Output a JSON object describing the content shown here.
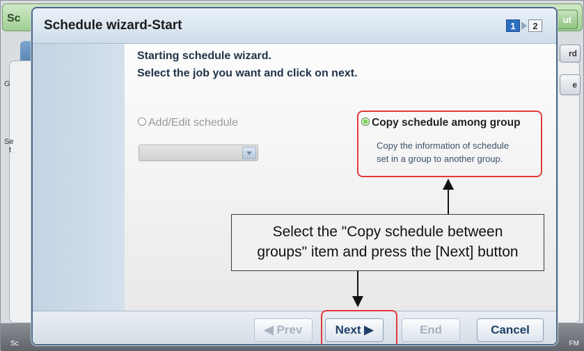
{
  "background": {
    "title": "Sc",
    "logout": "ut",
    "right_label": "rd",
    "right_btn_label": "e",
    "left_label_g": "G",
    "left_label_s": "Se",
    "left_label_t": "t",
    "status_left": "Sc",
    "status_right": "FM"
  },
  "dialog": {
    "title": "Schedule wizard-Start",
    "steps": {
      "current": "1",
      "next": "2"
    },
    "intro_line1": "Starting schedule wizard.",
    "intro_line2": "Select the job you want and click on next.",
    "option_add": {
      "label": "Add/Edit schedule",
      "selected": false,
      "enabled": false
    },
    "option_copy": {
      "label": "Copy schedule among group",
      "selected": true,
      "desc_line1": "Copy the information of schedule",
      "desc_line2": "set in a group to another group."
    },
    "callout_line1": "Select the \"Copy schedule between",
    "callout_line2": "groups\" item and press the [Next] button",
    "buttons": {
      "prev": "◀ Prev",
      "next": "Next ▶",
      "end": "End",
      "cancel": "Cancel"
    }
  },
  "colors": {
    "highlight": "#e23a3a",
    "step_active": "#2d6fc0",
    "selected_radio": "#7ad35a"
  }
}
